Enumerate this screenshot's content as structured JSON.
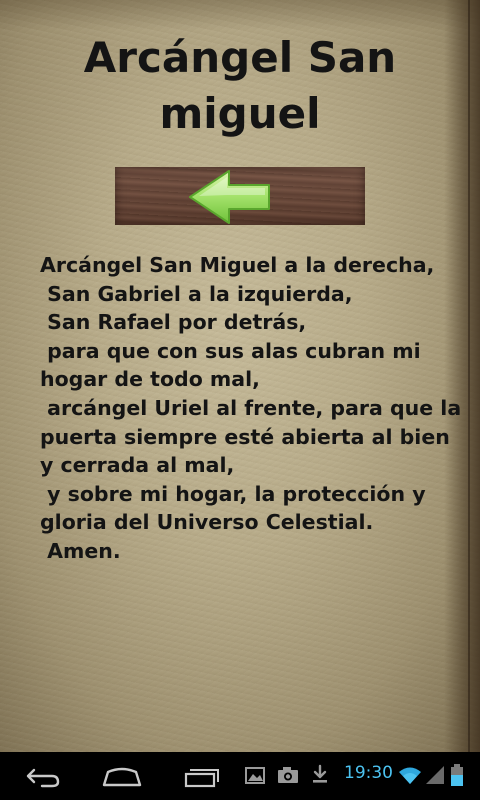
{
  "page": {
    "title": "Arcángel San miguel",
    "title_lines": [
      "Arcángel San",
      "miguel"
    ]
  },
  "back_button": {
    "icon": "left-arrow-icon",
    "arrow_color": "#9ee06a"
  },
  "prayer": {
    "lines": [
      "Arcángel San Miguel a la derecha,",
      " San Gabriel a la izquierda,",
      " San Rafael por detrás,",
      " para que con sus alas cubran mi",
      "hogar de todo mal,",
      " arcángel Uriel al frente, para que la",
      "puerta siempre esté abierta al bien",
      "y cerrada al mal,",
      " y sobre mi hogar, la protección y",
      "gloria del Universo Celestial.",
      " Amen."
    ]
  },
  "system_bar": {
    "time": "19:30",
    "accent_color": "#4cc3f1",
    "buttons": [
      "back-icon",
      "home-icon",
      "recent-apps-icon"
    ],
    "notifications": [
      "gallery-icon",
      "camera-icon",
      "download-icon"
    ],
    "status": [
      "wifi-icon",
      "signal-icon",
      "battery-icon"
    ]
  }
}
